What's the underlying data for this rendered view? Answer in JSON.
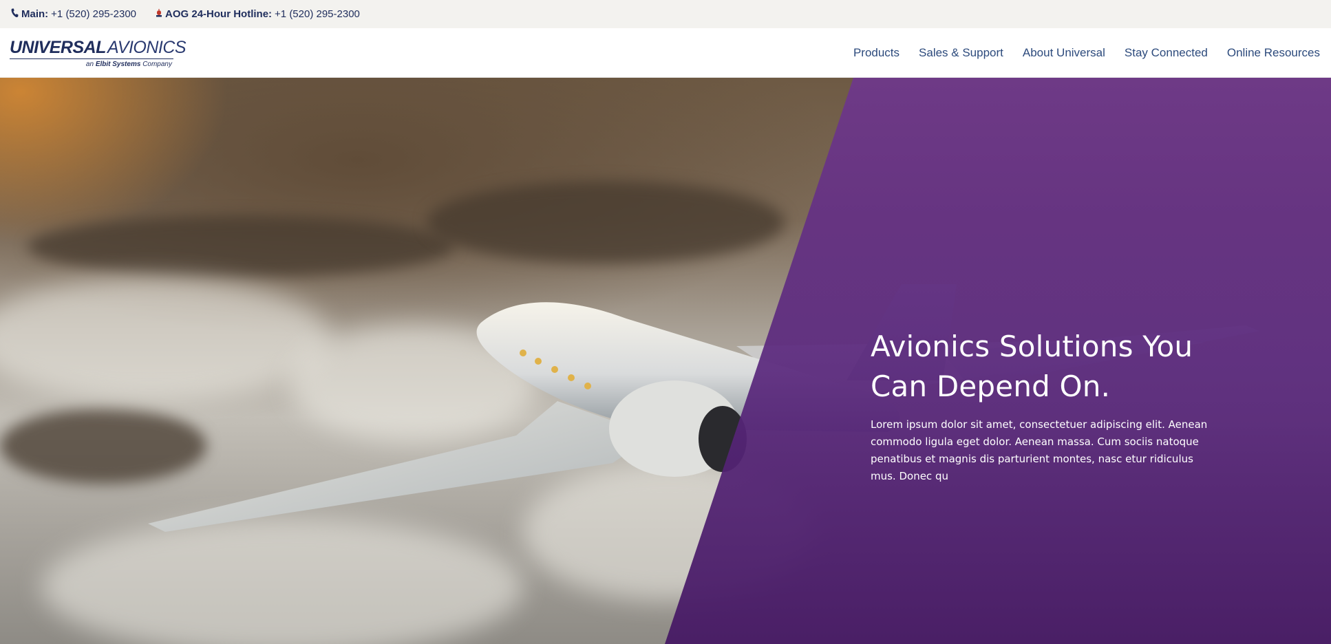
{
  "util_bar": {
    "main_label": "Main:",
    "main_phone": "+1 (520) 295-2300",
    "aog_label": "AOG 24-Hour Hotline:",
    "aog_phone": "+1 (520) 295-2300"
  },
  "header": {
    "logo": {
      "word1": "UNIVERSAL",
      "word2": "AVIONICS",
      "sub_prefix": "an",
      "sub_brand": "Elbit Systems",
      "sub_suffix": "Company"
    },
    "nav": [
      {
        "label": "Products"
      },
      {
        "label": "Sales & Support"
      },
      {
        "label": "About Universal"
      },
      {
        "label": "Stay Connected"
      },
      {
        "label": "Online Resources"
      }
    ]
  },
  "hero": {
    "title_line1": "Avionics Solutions You",
    "title_line2": "Can Depend On.",
    "text": "Lorem ipsum dolor sit amet, consectetuer adipiscing elit. Aenean commodo ligula eget dolor. Aenean massa. Cum sociis natoque penatibus et magnis dis parturient montes, nasc etur ridiculus mus. Donec qu"
  },
  "colors": {
    "brand_navy": "#1f2d5c",
    "nav_blue": "#2c4a7c",
    "util_bg": "#f3f2ef",
    "hero_purple": "#5a2a80",
    "siren_red": "#c0392b"
  },
  "icons": {
    "main": "phone-icon",
    "aog": "siren-icon"
  }
}
